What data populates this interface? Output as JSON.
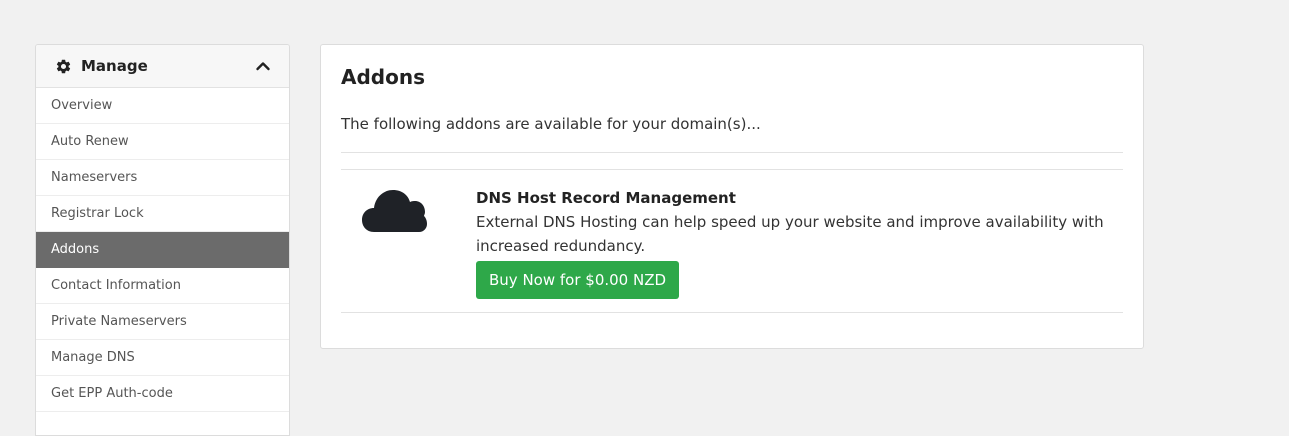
{
  "sidebar": {
    "title": "Manage",
    "items": [
      {
        "label": "Overview",
        "active": false
      },
      {
        "label": "Auto Renew",
        "active": false
      },
      {
        "label": "Nameservers",
        "active": false
      },
      {
        "label": "Registrar Lock",
        "active": false
      },
      {
        "label": "Addons",
        "active": true
      },
      {
        "label": "Contact Information",
        "active": false
      },
      {
        "label": "Private Nameservers",
        "active": false
      },
      {
        "label": "Manage DNS",
        "active": false
      },
      {
        "label": "Get EPP Auth-code",
        "active": false
      }
    ]
  },
  "main": {
    "title": "Addons",
    "intro": "The following addons are available for your domain(s)...",
    "addon": {
      "icon": "cloud-icon",
      "name": "DNS Host Record Management",
      "description": "External DNS Hosting can help speed up your website and improve availability with increased redundancy.",
      "button_label": "Buy Now for $0.00 NZD"
    }
  },
  "colors": {
    "active_nav": "#6b6b6b",
    "buy_button": "#2ea849",
    "background": "#f1f1f1"
  }
}
